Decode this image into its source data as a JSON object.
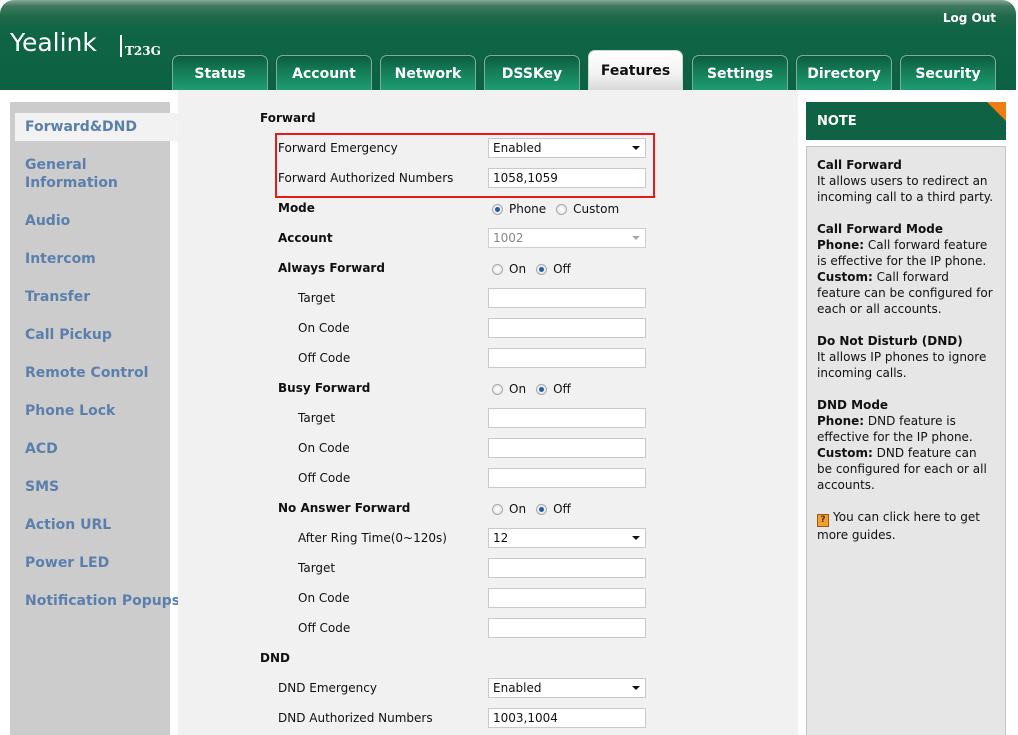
{
  "header": {
    "brand": "Yealink",
    "model": "T23G",
    "logout_label": "Log Out",
    "accent_color": "#0c6143"
  },
  "tabs": [
    {
      "label": "Status",
      "active": false
    },
    {
      "label": "Account",
      "active": false
    },
    {
      "label": "Network",
      "active": false
    },
    {
      "label": "DSSKey",
      "active": false
    },
    {
      "label": "Features",
      "active": true
    },
    {
      "label": "Settings",
      "active": false
    },
    {
      "label": "Directory",
      "active": false
    },
    {
      "label": "Security",
      "active": false
    }
  ],
  "sidebar": {
    "items": [
      {
        "label": "Forward&DND",
        "active": true
      },
      {
        "label": "General Information",
        "active": false
      },
      {
        "label": "Audio",
        "active": false
      },
      {
        "label": "Intercom",
        "active": false
      },
      {
        "label": "Transfer",
        "active": false
      },
      {
        "label": "Call Pickup",
        "active": false
      },
      {
        "label": "Remote Control",
        "active": false
      },
      {
        "label": "Phone Lock",
        "active": false
      },
      {
        "label": "ACD",
        "active": false
      },
      {
        "label": "SMS",
        "active": false
      },
      {
        "label": "Action URL",
        "active": false
      },
      {
        "label": "Power LED",
        "active": false
      },
      {
        "label": "Notification Popups",
        "active": false
      }
    ]
  },
  "forward": {
    "section_title": "Forward",
    "forward_emergency": {
      "label": "Forward Emergency",
      "value": "Enabled"
    },
    "forward_authorized_numbers": {
      "label": "Forward Authorized Numbers",
      "value": "1058,1059"
    },
    "mode": {
      "label": "Mode",
      "options": [
        "Phone",
        "Custom"
      ],
      "selected": "Phone"
    },
    "account": {
      "label": "Account",
      "value": "1002",
      "disabled": true
    },
    "always_forward": {
      "label": "Always Forward",
      "on_label": "On",
      "off_label": "Off",
      "selected": "Off",
      "target": {
        "label": "Target",
        "value": ""
      },
      "on_code": {
        "label": "On Code",
        "value": ""
      },
      "off_code": {
        "label": "Off Code",
        "value": ""
      }
    },
    "busy_forward": {
      "label": "Busy Forward",
      "on_label": "On",
      "off_label": "Off",
      "selected": "Off",
      "target": {
        "label": "Target",
        "value": ""
      },
      "on_code": {
        "label": "On Code",
        "value": ""
      },
      "off_code": {
        "label": "Off Code",
        "value": ""
      }
    },
    "no_answer_forward": {
      "label": "No Answer Forward",
      "on_label": "On",
      "off_label": "Off",
      "selected": "Off",
      "after_ring_time": {
        "label": "After Ring Time(0~120s)",
        "value": "12"
      },
      "target": {
        "label": "Target",
        "value": ""
      },
      "on_code": {
        "label": "On Code",
        "value": ""
      },
      "off_code": {
        "label": "Off Code",
        "value": ""
      }
    },
    "highlight_color": "#e41b1b"
  },
  "dnd": {
    "section_title": "DND",
    "dnd_emergency": {
      "label": "DND Emergency",
      "value": "Enabled"
    },
    "dnd_authorized_numbers": {
      "label": "DND Authorized Numbers",
      "value": "1003,1004"
    }
  },
  "note": {
    "title": "NOTE",
    "blocks": [
      {
        "title": "Call Forward",
        "text": "It allows users to redirect an incoming call to a third party."
      },
      {
        "title": "Call Forward Mode",
        "phone_label": "Phone:",
        "phone_text": " Call forward feature is effective for the IP phone.",
        "custom_label": "Custom:",
        "custom_text": " Call forward feature can be configured for each or all accounts."
      },
      {
        "title": "Do Not Disturb (DND)",
        "text": "It allows IP phones to ignore incoming calls."
      },
      {
        "title": "DND Mode",
        "phone_label": "Phone:",
        "phone_text": " DND feature is effective for the IP phone.",
        "custom_label": "Custom:",
        "custom_text": " DND feature can be configured for each or all accounts."
      }
    ],
    "guide_icon": "help-icon",
    "guide_text": "You can click here to get more guides.",
    "corner_color": "#f07c12"
  }
}
